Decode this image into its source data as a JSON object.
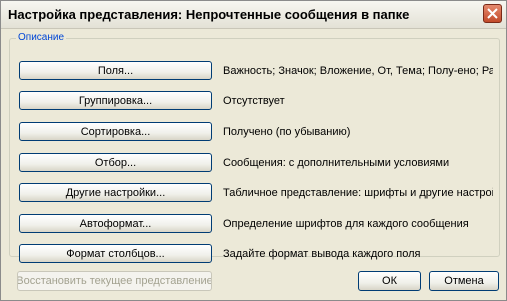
{
  "window": {
    "title": "Настройка представления: Непрочтенные сообщения в папке"
  },
  "group": {
    "legend": "Описание",
    "rows": [
      {
        "button": "Поля...",
        "desc": "Важность; Значок; Вложение, От, Тема; Полу-ено; Разм..."
      },
      {
        "button": "Группировка...",
        "desc": "Отсутствует"
      },
      {
        "button": "Сортировка...",
        "desc": "Получено (по убыванию)"
      },
      {
        "button": "Отбор...",
        "desc": "Сообщения: с дополнительными условиями"
      },
      {
        "button": "Другие настройки...",
        "desc": "Табличное представление: шрифты и другие настройки"
      },
      {
        "button": "Автоформат...",
        "desc": "Определение шрифтов для каждого сообщения"
      },
      {
        "button": "Формат столбцов...",
        "desc": "Задайте формат вывода каждого поля"
      }
    ]
  },
  "buttons": {
    "restore": "Восстановить текущее представление",
    "ok": "ОК",
    "cancel": "Отмена"
  },
  "colors": {
    "legend": "#0046d5",
    "button_border": "#003c74",
    "dialog_bg": "#ece9d8"
  },
  "icons": {
    "close": "close-icon"
  }
}
